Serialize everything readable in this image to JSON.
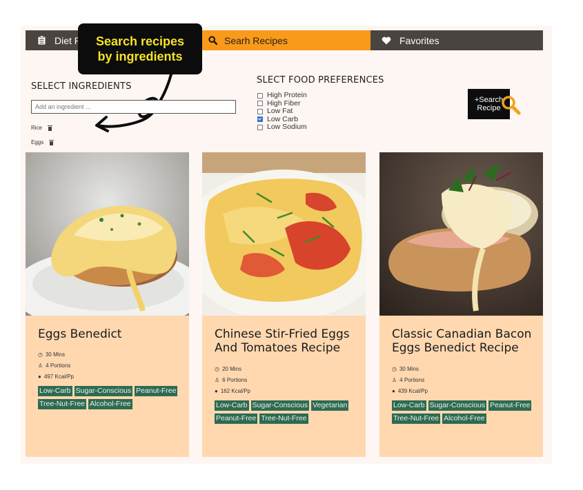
{
  "nav": {
    "tabs": [
      {
        "label": "Diet Pl",
        "icon": "clipboard-icon"
      },
      {
        "label": "Searh Recipes",
        "icon": "search-icon"
      },
      {
        "label": "Favorites",
        "icon": "heart-icon"
      }
    ]
  },
  "callout": {
    "line1": "Search recipes",
    "line2": "by ingredients"
  },
  "ingredients": {
    "title": "SELECT INGREDIENTS",
    "placeholder": "Add an ingredient ...",
    "items": [
      "Rice",
      "Eggs"
    ]
  },
  "preferences": {
    "title": "SLECT FOOD PREFERENCES",
    "options": [
      {
        "label": "High Protein",
        "checked": false
      },
      {
        "label": "High Fiber",
        "checked": false
      },
      {
        "label": "Low Fat",
        "checked": false
      },
      {
        "label": "Low Carb",
        "checked": true
      },
      {
        "label": "Low Sodium",
        "checked": false
      }
    ]
  },
  "search_button": {
    "line1": "+Search",
    "line2": "Recipe"
  },
  "recipes": [
    {
      "title": "Eggs Benedict",
      "time": "30 Mins",
      "portions": "4 Portions",
      "kcal": "497 Kcal/Pp",
      "tags": [
        "Low-Carb",
        "Sugar-Conscious",
        "Peanut-Free",
        "Tree-Nut-Free",
        "Alcohol-Free"
      ]
    },
    {
      "title": "Chinese Stir-Fried Eggs And Tomatoes Recipe",
      "time": "20 Mins",
      "portions": "6 Portions",
      "kcal": "162 Kcal/Pp",
      "tags": [
        "Low-Carb",
        "Sugar-Conscious",
        "Vegetarian",
        "Peanut-Free",
        "Tree-Nut-Free"
      ]
    },
    {
      "title": "Classic Canadian Bacon Eggs Benedict Recipe",
      "time": "30 Mins",
      "portions": "4 Portions",
      "kcal": "439 Kcal/Pp",
      "tags": [
        "Low-Carb",
        "Sugar-Conscious",
        "Peanut-Free",
        "Tree-Nut-Free",
        "Alcohol-Free"
      ]
    }
  ],
  "colors": {
    "nav_dark": "#4a4441",
    "nav_active": "#f99a1a",
    "card_bg": "#ffd8b0",
    "tag_bg": "#2e6a52",
    "callout_text": "#f5e326"
  }
}
